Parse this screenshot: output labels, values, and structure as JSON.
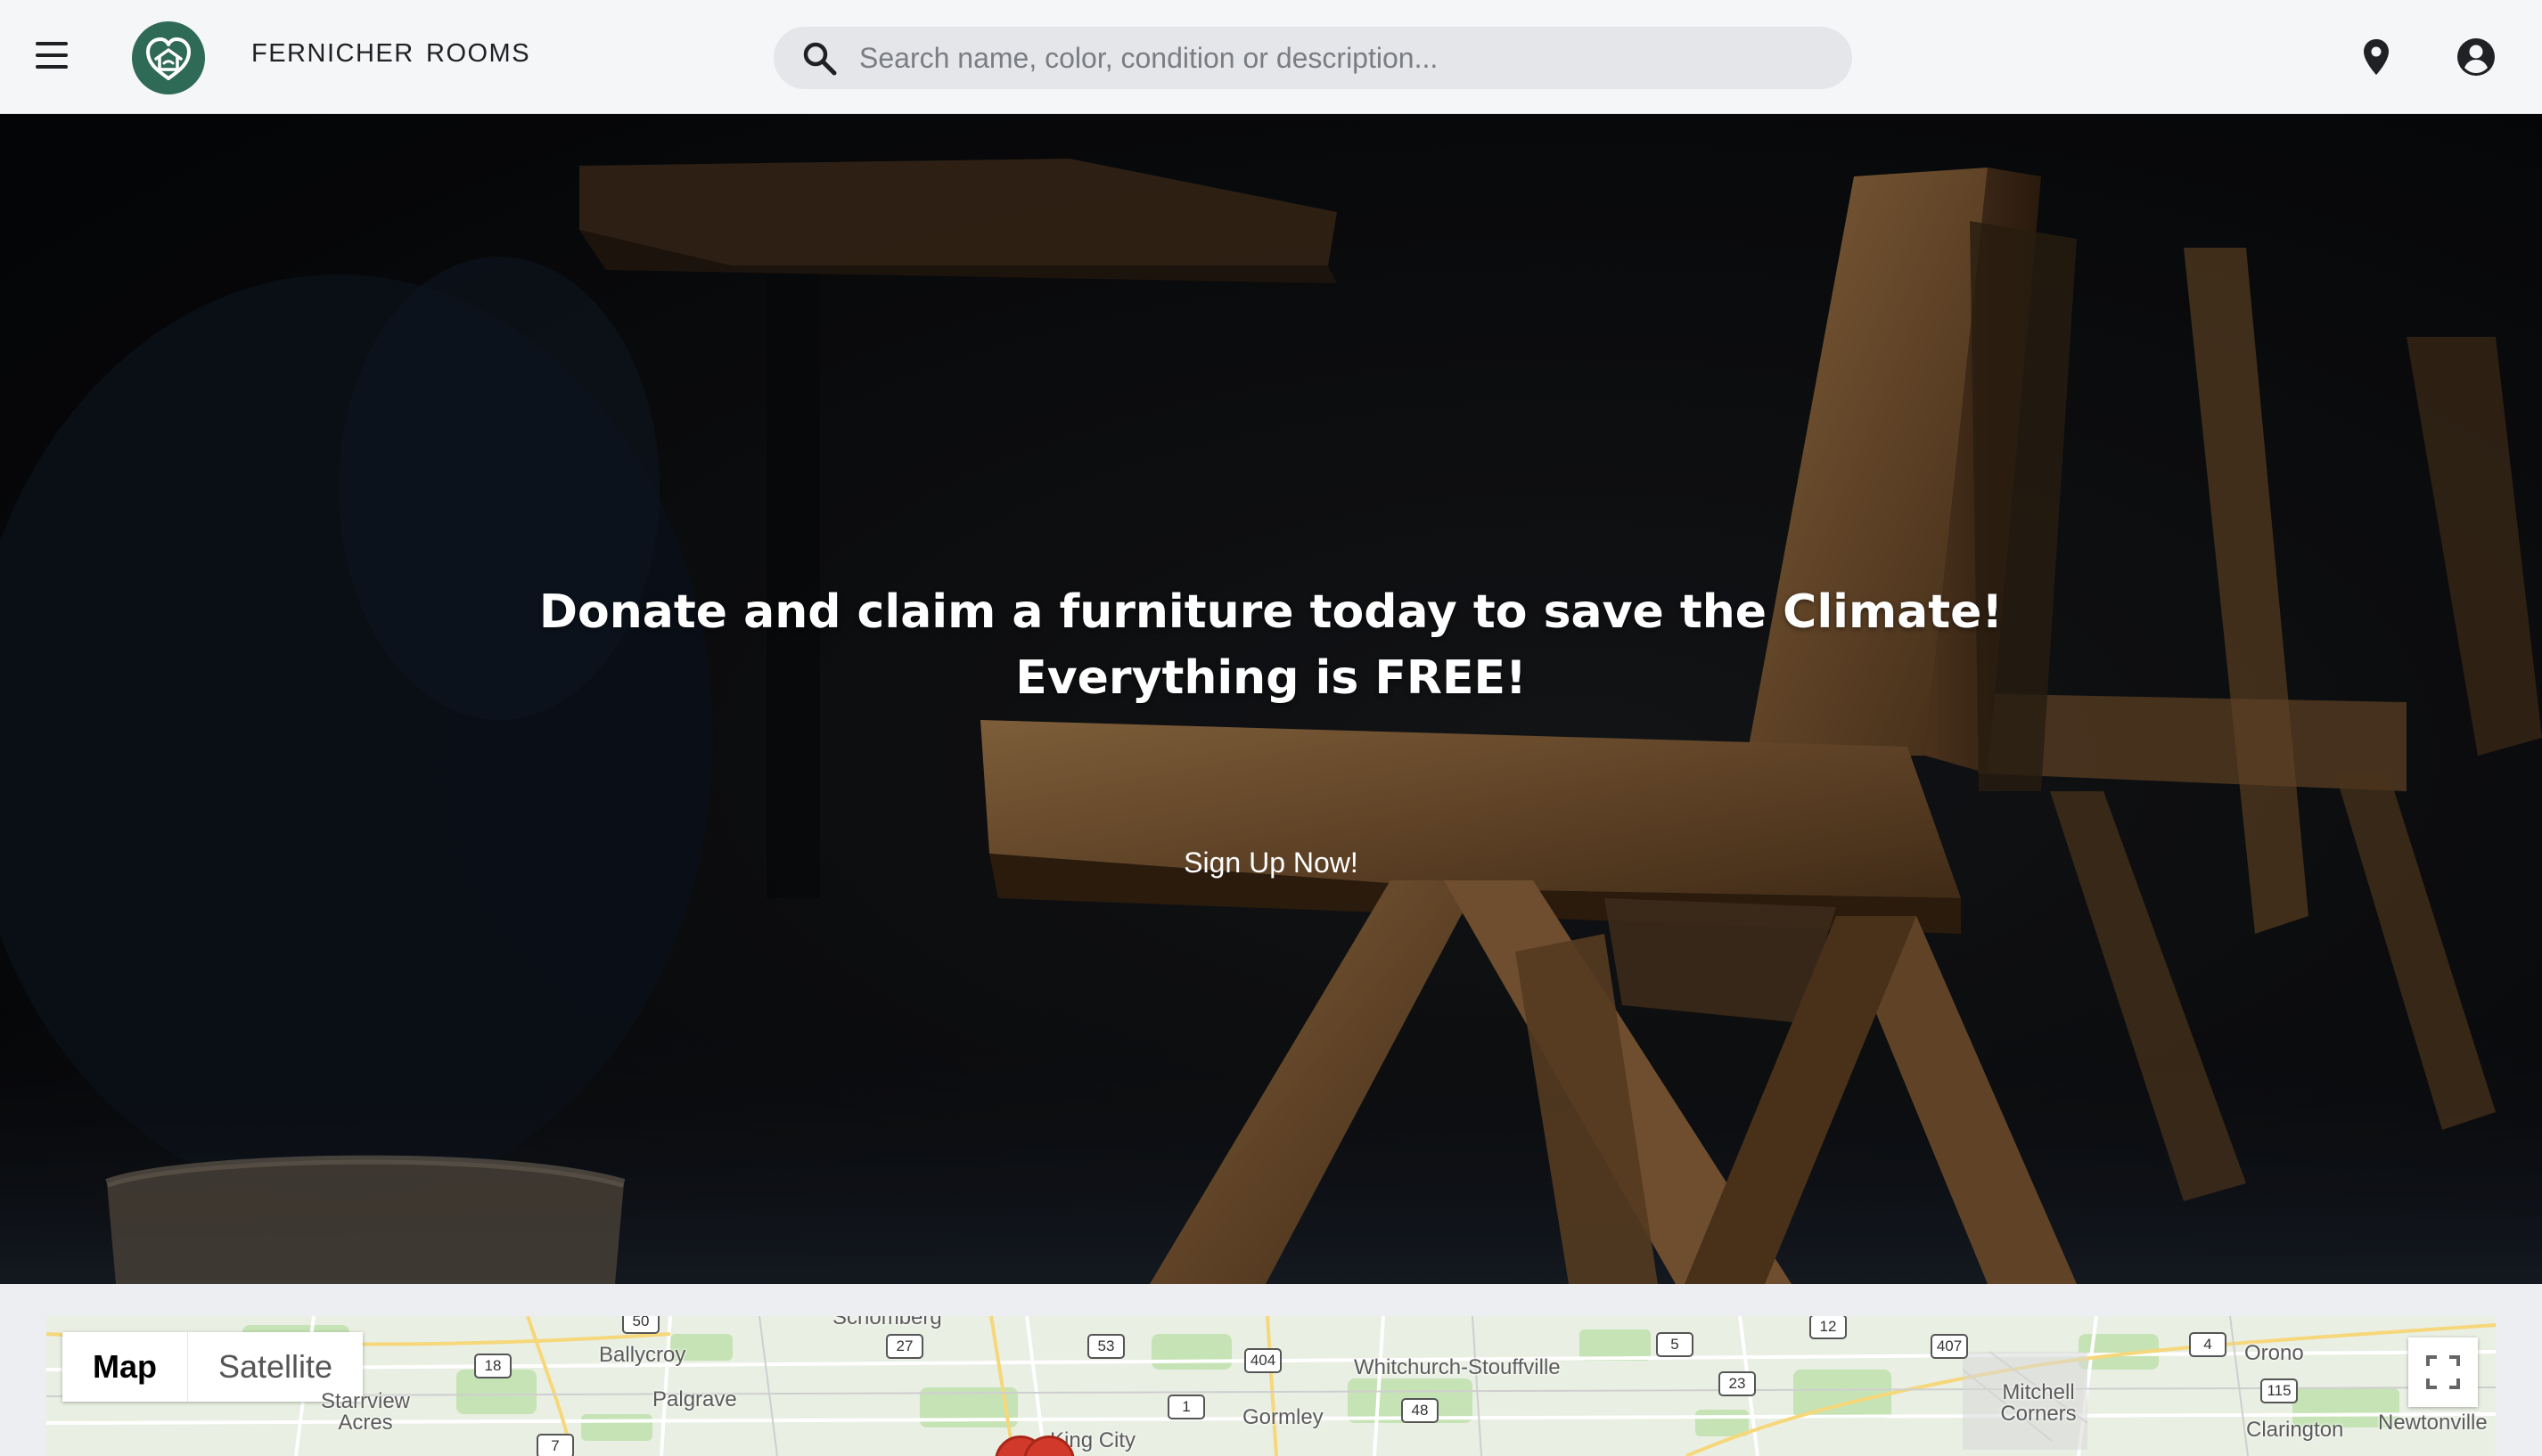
{
  "header": {
    "menu_icon": "hamburger-menu-icon",
    "logo_icon": "heart-house-logo-icon",
    "nav": [
      {
        "label": "FERNICHER"
      },
      {
        "label": "ROOMS"
      }
    ],
    "search": {
      "icon": "search-icon",
      "placeholder": "Search name, color, condition or description...",
      "value": ""
    },
    "location_icon": "location-pin-icon",
    "account_icon": "account-circle-icon"
  },
  "hero": {
    "headline_line1": "Donate and claim a furniture today to save the Climate!",
    "headline_line2": "Everything is FREE!",
    "cta_label": "Sign Up Now!"
  },
  "map": {
    "type_controls": [
      {
        "label": "Map",
        "selected": true
      },
      {
        "label": "Satellite",
        "selected": false
      }
    ],
    "fullscreen_icon": "fullscreen-icon",
    "places": [
      "Schomberg",
      "Ballycroy",
      "Palgrave",
      "Starrview Acres",
      "Whitchurch-Stouffville",
      "Gormley",
      "King City",
      "Mitchell Corners",
      "Orono",
      "Clarington",
      "Newtonville"
    ],
    "highways": [
      "50",
      "18",
      "27",
      "7",
      "53",
      "404",
      "1",
      "48",
      "5",
      "23",
      "12",
      "407",
      "4",
      "115"
    ]
  },
  "colors": {
    "header_bg": "#f5f6f8",
    "search_bg": "#e5e6e9",
    "logo_green": "#2e6a55",
    "marker_red": "#d13a2a",
    "hero_text": "#ffffff"
  }
}
